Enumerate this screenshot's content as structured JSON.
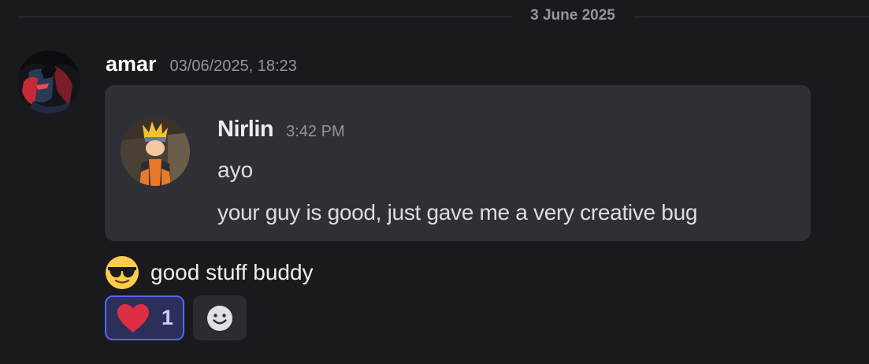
{
  "date_divider": "3 June 2025",
  "message": {
    "author": "amar",
    "timestamp": "03/06/2025, 18:23",
    "avatar_icon": "anime-avatar-dark-red",
    "embed": {
      "author": "Nirlin",
      "timestamp": "3:42 PM",
      "avatar_icon": "ninja-character-avatar",
      "lines": [
        "ayo",
        "your guy is good, just gave me a very creative bug"
      ]
    },
    "reply_emoji": "sunglasses-emoji",
    "reply_text": "good stuff buddy",
    "reactions": [
      {
        "emoji": "heart-emoji",
        "count": "1"
      }
    ],
    "add_reaction_icon": "smiley-add-reaction-icon"
  },
  "colors": {
    "background": "#1a1a1e",
    "embed_background": "#2f3035",
    "reaction_border": "#5865f2",
    "reaction_background": "#2c2f5a"
  }
}
